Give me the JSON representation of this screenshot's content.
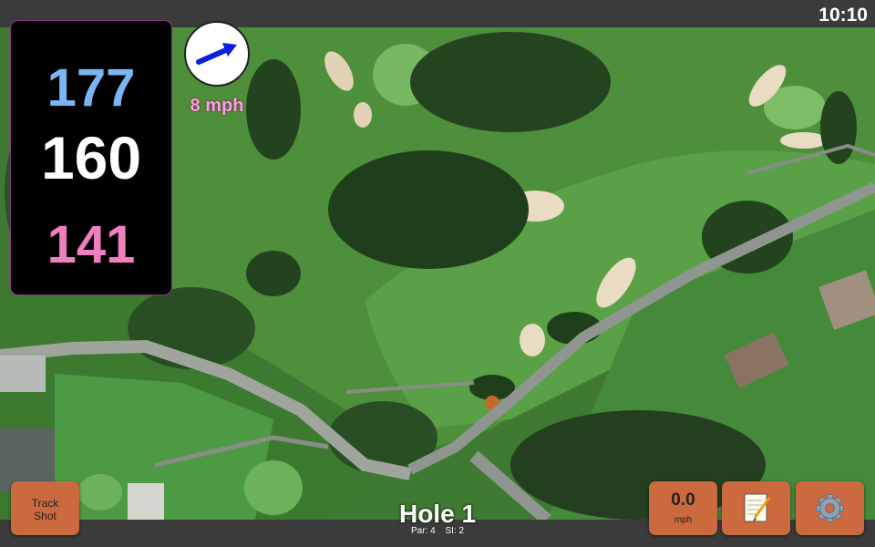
{
  "status": {
    "time": "10:10"
  },
  "distances": {
    "back": "177",
    "middle": "160",
    "front": "141"
  },
  "wind": {
    "speed": "8 mph",
    "icon": "wind-arrow-icon",
    "color": "#0a1fe0"
  },
  "hole": {
    "title": "Hole 1",
    "par": "Par: 4",
    "si": "SI: 2"
  },
  "buttons": {
    "track_shot": "Track Shot",
    "speed_value": "0.0",
    "speed_unit": "mph",
    "notes_icon": "notepad-icon",
    "settings_icon": "gear-icon"
  },
  "colors": {
    "button": "#cc6a3f",
    "back_distance": "#7bb6f4",
    "front_distance": "#f07fc0",
    "wind_text": "#ff9df0"
  }
}
